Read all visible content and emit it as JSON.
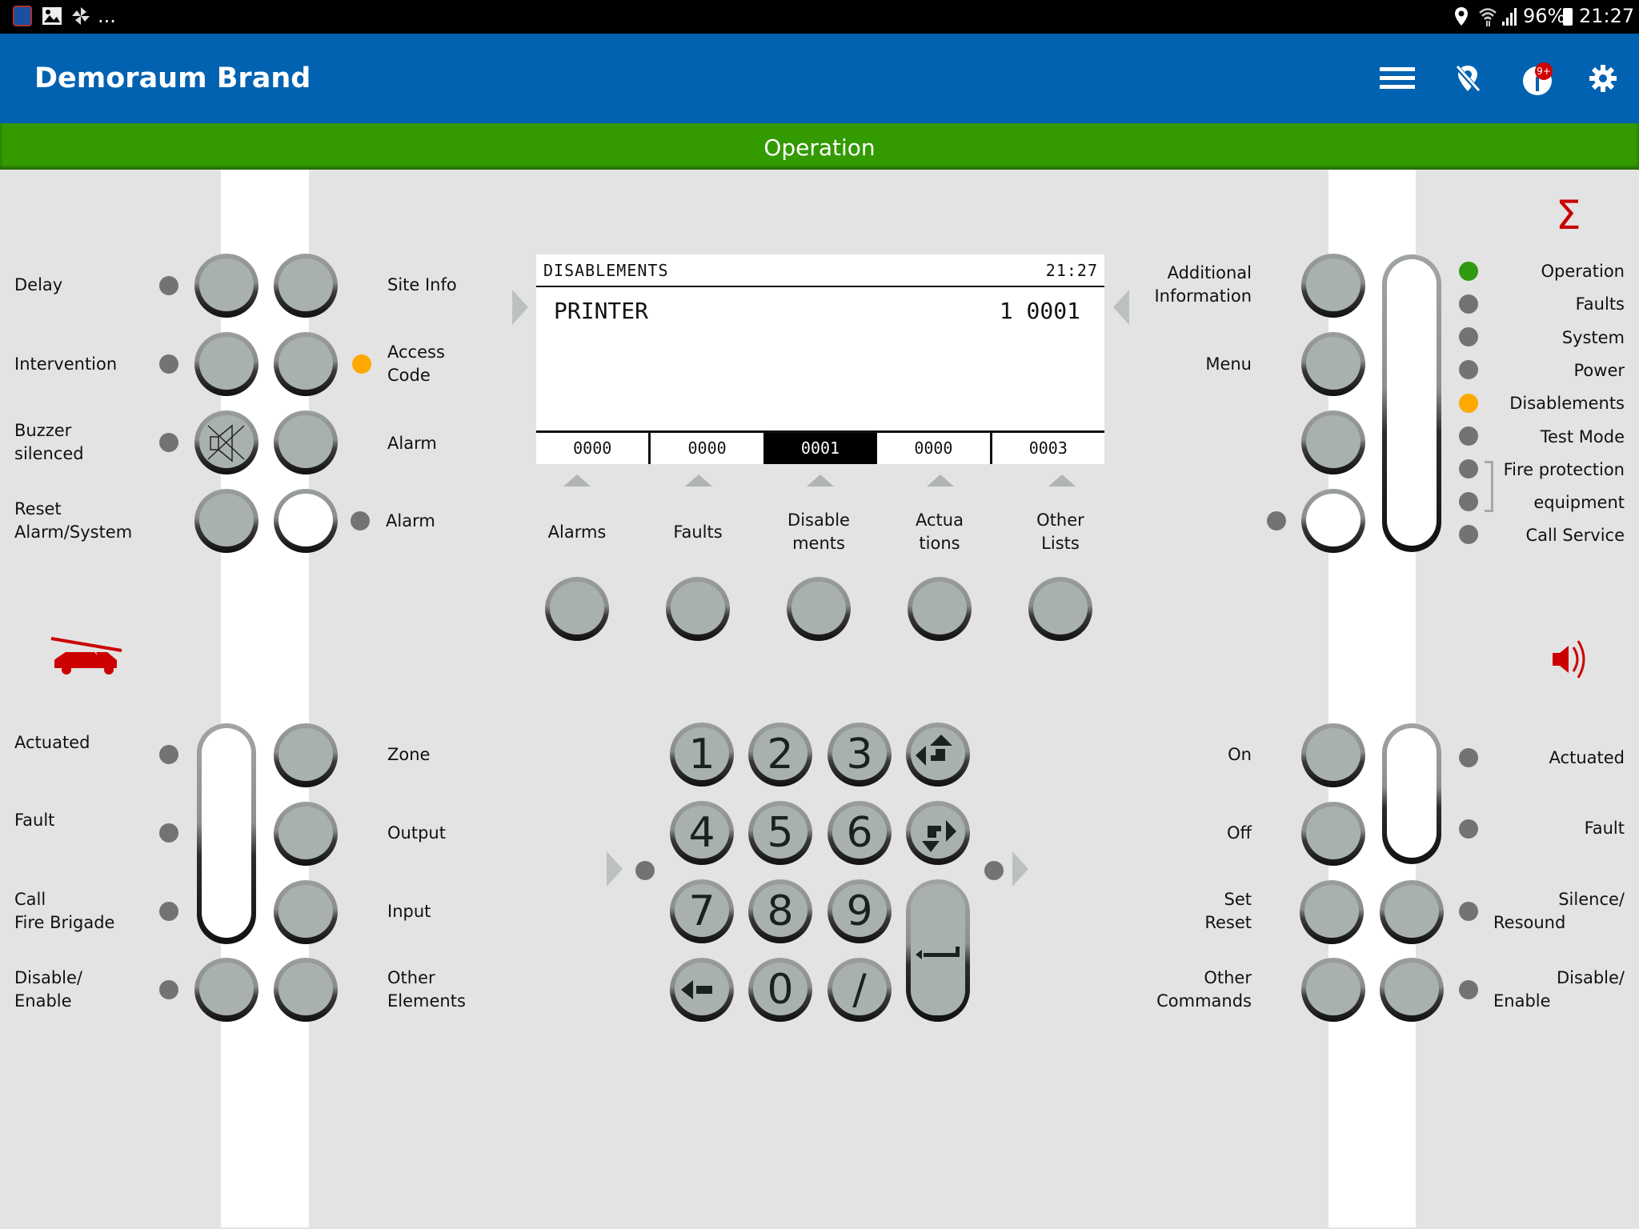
{
  "status_bar": {
    "left_icons": [
      "calculator-app-icon",
      "gallery-icon",
      "pinwheel-icon"
    ],
    "overflow": "...",
    "right_icons": [
      "location-icon",
      "wifi-icon",
      "signal-icon"
    ],
    "battery": "96%",
    "time": "21:27"
  },
  "app_bar": {
    "title": "Demoraum Brand",
    "actions": [
      {
        "name": "menu-icon"
      },
      {
        "name": "location-off-icon"
      },
      {
        "name": "notifications-icon",
        "badge": "9+"
      },
      {
        "name": "settings-icon"
      }
    ]
  },
  "mode": {
    "label": "Operation",
    "color": "#339a00"
  },
  "colors": {
    "brand": "#0062b0",
    "led_on_green": "#2f9a12",
    "led_on_orange": "#ffa800",
    "led_off": "#737373",
    "icon_red": "#cc0000"
  },
  "left_top": {
    "rows": [
      {
        "label": "Delay",
        "right_label": "Site Info",
        "led": "off"
      },
      {
        "label": "Intervention",
        "right_label": "Access\nCode",
        "right_led": "orange",
        "led": "off"
      },
      {
        "label": "Buzzer\nsilenced",
        "right_label": "Alarm",
        "led": "off"
      },
      {
        "label": "Reset\nAlarm/System",
        "right_label": "Alarm",
        "right_led": "off"
      }
    ]
  },
  "display": {
    "title": "DISABLEMENTS",
    "time": "21:27",
    "entry_label": "PRINTER",
    "entry_value": "1 0001",
    "counters": [
      {
        "value": "0000",
        "selected": false
      },
      {
        "value": "0000",
        "selected": false
      },
      {
        "value": "0001",
        "selected": true
      },
      {
        "value": "0000",
        "selected": false
      },
      {
        "value": "0003",
        "selected": false
      }
    ]
  },
  "soft_keys": [
    {
      "label": "Alarms"
    },
    {
      "label": "Faults"
    },
    {
      "label": "Disable\nments"
    },
    {
      "label": "Actua\ntions"
    },
    {
      "label": "Other\nLists"
    }
  ],
  "right_top": {
    "buttons": [
      {
        "label": "Additional\nInformation"
      },
      {
        "label": "Menu"
      },
      {
        "label": ""
      },
      {
        "label": ""
      }
    ],
    "status_leds": [
      {
        "label": "Operation",
        "state": "green"
      },
      {
        "label": "Faults",
        "state": "off"
      },
      {
        "label": "System",
        "state": "off"
      },
      {
        "label": "Power",
        "state": "off"
      },
      {
        "label": "Disablements",
        "state": "orange"
      },
      {
        "label": "Test Mode",
        "state": "off"
      },
      {
        "label": "Fire protection",
        "state": "off"
      },
      {
        "label": "equipment",
        "state": "off"
      },
      {
        "label": "Call Service",
        "state": "off"
      }
    ],
    "sum_symbol": "Σ"
  },
  "left_bottom": {
    "rows": [
      {
        "label": "Actuated",
        "right_label": "Zone"
      },
      {
        "label": "Fault",
        "right_label": "Output"
      },
      {
        "label": "Call\nFire Brigade",
        "right_label": "Input"
      },
      {
        "label": "Disable/\nEnable",
        "right_label": "Other\nElements"
      }
    ]
  },
  "keypad": {
    "keys": [
      "1",
      "2",
      "3",
      "4",
      "5",
      "6",
      "7",
      "8",
      "9",
      "0",
      "/"
    ],
    "special": [
      "nav-up-left-icon",
      "nav-down-right-icon",
      "backspace-icon",
      "enter-icon"
    ]
  },
  "right_bottom": {
    "rows": [
      {
        "label": "On",
        "right_label": "Actuated"
      },
      {
        "label": "Off",
        "right_label": "Fault"
      },
      {
        "label": "Set\nReset",
        "right_label": "Silence/\nResound"
      },
      {
        "label": "Other\nCommands",
        "right_label": "Disable/\nEnable"
      }
    ]
  }
}
